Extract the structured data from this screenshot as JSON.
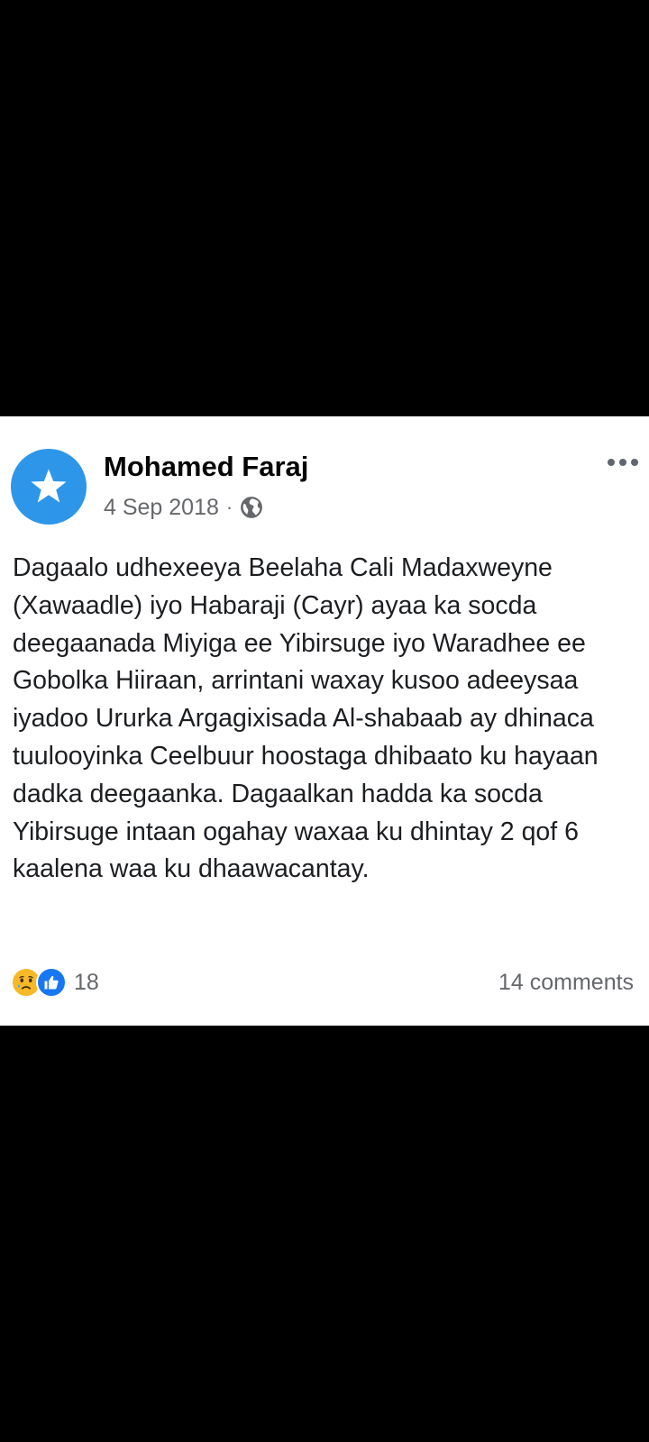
{
  "post": {
    "author": "Mohamed Faraj",
    "date": "4 Sep 2018",
    "separator": "·",
    "privacy_icon": "globe-icon",
    "avatar_icon": "star-icon",
    "text": "Dagaalo udhexeeya Beelaha Cali Madaxweyne (Xawaadle) iyo Habaraji (Cayr) ayaa ka socda deegaanada Miyiga ee Yibirsuge iyo Waradhee ee Gobolka Hiiraan, arrintani waxay kusoo adeeysaa iyadoo Ururka Argagixisada Al-shabaab ay dhinaca tuulooyinka Ceelbuur hoostaga dhibaato ku hayaan dadka deegaanka. Dagaalkan hadda ka socda Yibirsuge intaan ogahay waxaa ku dhintay 2 qof 6 kaalena waa ku dhaawacantay.",
    "reactions": {
      "icons": [
        "sad-reaction-icon",
        "like-reaction-icon"
      ],
      "count": "18"
    },
    "comments": "14 comments"
  },
  "colors": {
    "avatar_blue": "#2d96e8",
    "like_blue": "#1877f2",
    "sad_yellow": "#f7b928",
    "secondary_text": "#65676b"
  }
}
